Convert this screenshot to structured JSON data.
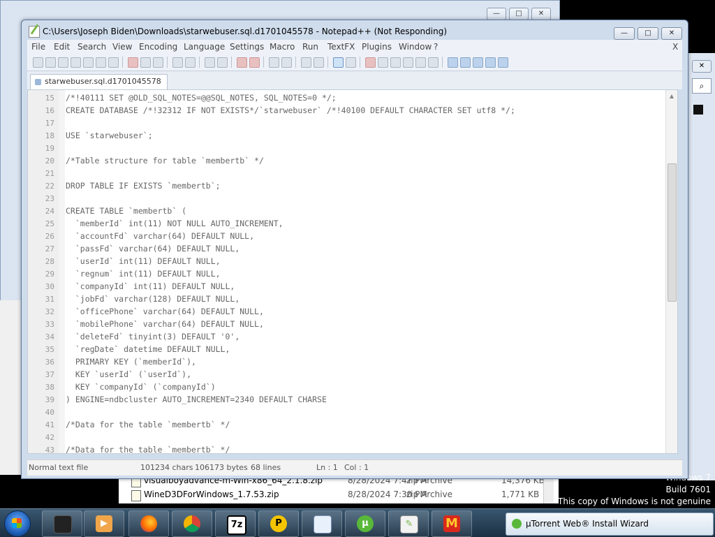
{
  "notepad": {
    "title": "C:\\Users\\Joseph Biden\\Downloads\\starwebuser.sql.d1701045578 - Notepad++ (Not Responding)",
    "menu": [
      "File",
      "Edit",
      "Search",
      "View",
      "Encoding",
      "Language",
      "Settings",
      "Macro",
      "Run",
      "TextFX",
      "Plugins",
      "Window",
      "?"
    ],
    "menu_close": "X",
    "tab_label": "starwebuser.sql.d1701045578",
    "lines": [
      {
        "n": "15",
        "t": "/*!40111 SET @OLD_SQL_NOTES=@@SQL_NOTES, SQL_NOTES=0 */;"
      },
      {
        "n": "16",
        "t": "CREATE DATABASE /*!32312 IF NOT EXISTS*/`starwebuser` /*!40100 DEFAULT CHARACTER SET utf8 */;"
      },
      {
        "n": "17",
        "t": ""
      },
      {
        "n": "18",
        "t": "USE `starwebuser`;"
      },
      {
        "n": "19",
        "t": ""
      },
      {
        "n": "20",
        "t": "/*Table structure for table `membertb` */"
      },
      {
        "n": "21",
        "t": ""
      },
      {
        "n": "22",
        "t": "DROP TABLE IF EXISTS `membertb`;"
      },
      {
        "n": "23",
        "t": ""
      },
      {
        "n": "24",
        "t": "CREATE TABLE `membertb` ("
      },
      {
        "n": "25",
        "t": "  `memberId` int(11) NOT NULL AUTO_INCREMENT,"
      },
      {
        "n": "26",
        "t": "  `accountFd` varchar(64) DEFAULT NULL,"
      },
      {
        "n": "27",
        "t": "  `passFd` varchar(64) DEFAULT NULL,"
      },
      {
        "n": "28",
        "t": "  `userId` int(11) DEFAULT NULL,"
      },
      {
        "n": "29",
        "t": "  `regnum` int(11) DEFAULT NULL,"
      },
      {
        "n": "30",
        "t": "  `companyId` int(11) DEFAULT NULL,"
      },
      {
        "n": "31",
        "t": "  `jobFd` varchar(128) DEFAULT NULL,"
      },
      {
        "n": "32",
        "t": "  `officePhone` varchar(64) DEFAULT NULL,"
      },
      {
        "n": "33",
        "t": "  `mobilePhone` varchar(64) DEFAULT NULL,"
      },
      {
        "n": "34",
        "t": "  `deleteFd` tinyint(3) DEFAULT '0',"
      },
      {
        "n": "35",
        "t": "  `regDate` datetime DEFAULT NULL,"
      },
      {
        "n": "36",
        "t": "  PRIMARY KEY (`memberId`),"
      },
      {
        "n": "37",
        "t": "  KEY `userId` (`userId`),"
      },
      {
        "n": "38",
        "t": "  KEY `companyId` (`companyId`)"
      },
      {
        "n": "39",
        "t": ") ENGINE=ndbcluster AUTO_INCREMENT=2340 DEFAULT CHARSE"
      },
      {
        "n": "40",
        "t": ""
      },
      {
        "n": "41",
        "t": "/*Data for the table `membertb` */"
      },
      {
        "n": "42",
        "t": ""
      },
      {
        "n": "43",
        "t": "/*Data for the table `membertb` */"
      }
    ],
    "status": {
      "type": "Normal text file",
      "chars": "101234 chars",
      "bytes": "106173 bytes",
      "lines": "68 lines",
      "ln": "Ln : 1",
      "col": "Col : 1"
    }
  },
  "explorer": {
    "rows": [
      {
        "name": "visualboyadvance-m-Win-x86_64_2.1.8.zip",
        "date": "8/28/2024 7:47 PM",
        "type": "zip Archive",
        "size": "14,376 KB"
      },
      {
        "name": "WineD3DForWindows_1.7.53.zip",
        "date": "8/28/2024 7:30 PM",
        "type": "zip Archive",
        "size": "1,771 KB"
      }
    ]
  },
  "desktop_notice": {
    "line1": "Windows 7",
    "line2": "Build 7601",
    "line3": "This copy of Windows is not genuine"
  },
  "taskbar": {
    "zip_label": "7z",
    "wizard_label": "µTorrent Web® Install Wizard"
  },
  "colors": {
    "taskbar": "#1b3043",
    "notepad_frame": "#cfdcec",
    "code_text": "#666666"
  }
}
